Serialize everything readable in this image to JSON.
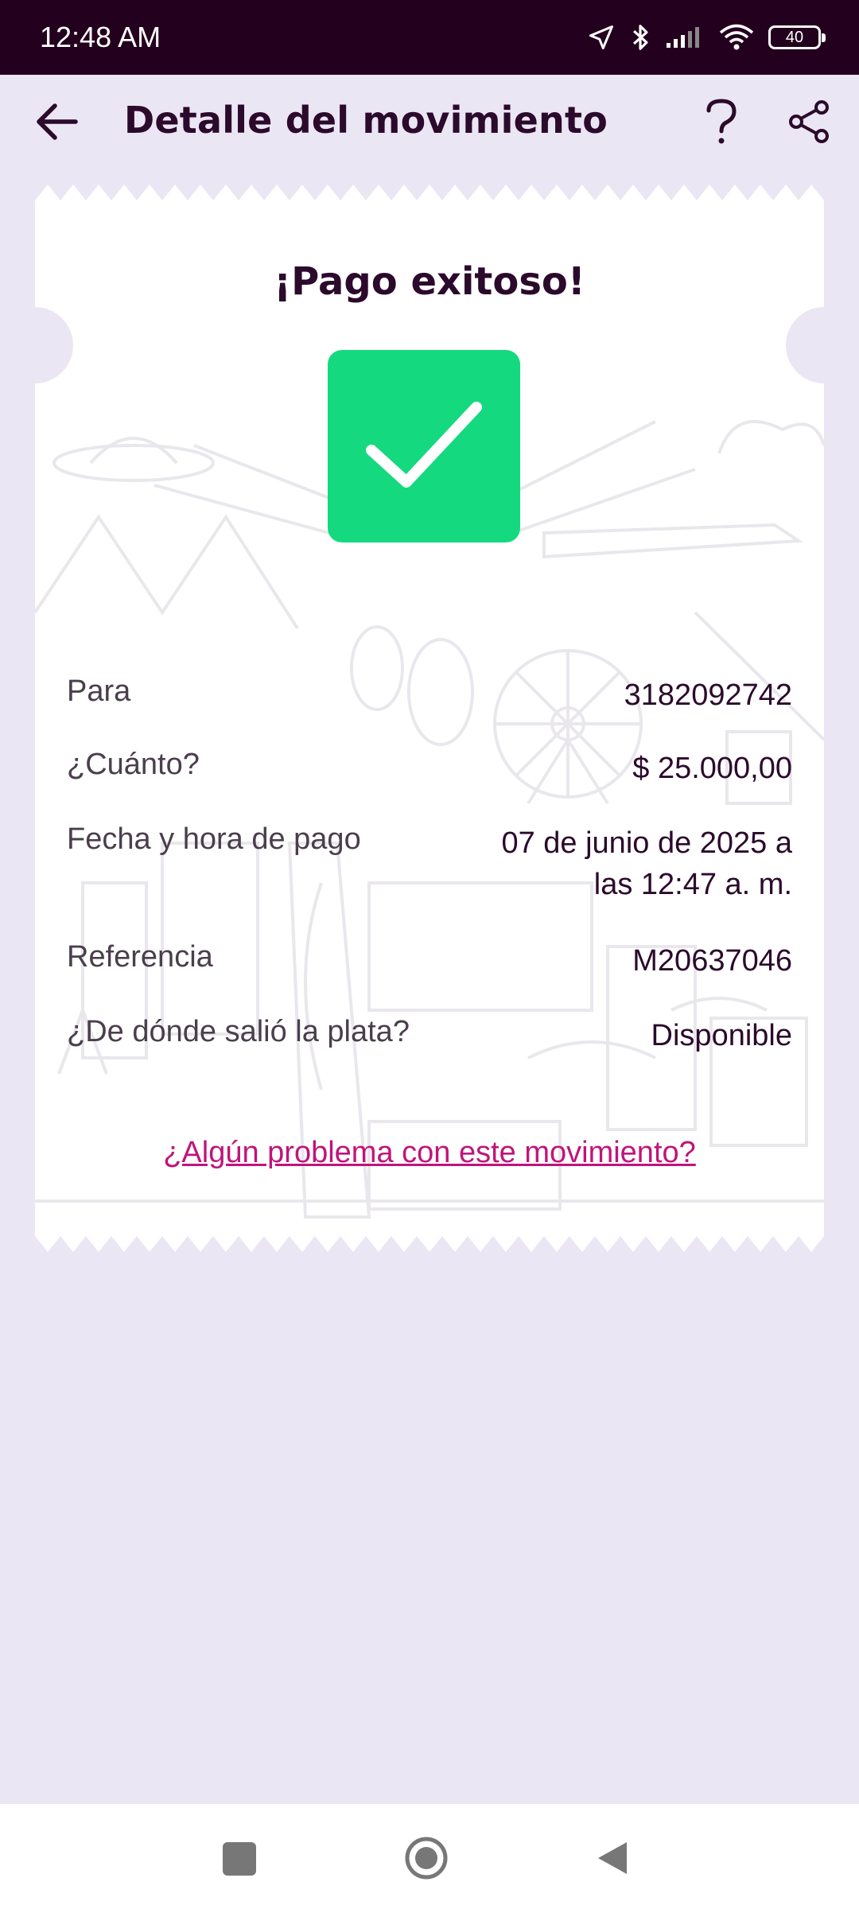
{
  "status_bar": {
    "time": "12:48 AM",
    "battery": "40",
    "icons": [
      "location-icon",
      "bluetooth-icon",
      "signal-icon",
      "wifi-icon",
      "battery-icon"
    ]
  },
  "header": {
    "title": "Detalle del movimiento",
    "icons": [
      "back-arrow-icon",
      "help-icon",
      "share-icon"
    ]
  },
  "receipt": {
    "title": "¡Pago exitoso!",
    "status_icon": "check-icon",
    "rows": [
      {
        "label": "Para",
        "value": "3182092742"
      },
      {
        "label": "¿Cuánto?",
        "value": "$ 25.000,00"
      },
      {
        "label": "Fecha y hora de pago",
        "value_line1": "07 de junio de 2025 a",
        "value_line2": "las 12:47 a. m."
      },
      {
        "label": "Referencia",
        "value": "M20637046"
      },
      {
        "label": "¿De dónde salió la plata?",
        "value": "Disponible"
      }
    ],
    "problem_link": "¿Algún problema con este movimiento?"
  },
  "colors": {
    "status_bar": "#23001e",
    "background": "#ebe6f4",
    "success_green": "#14d97f",
    "link_magenta": "#c0147b",
    "title_text": "#2b0a2c"
  },
  "nav_bar": {
    "icons": [
      "recent-apps-icon",
      "home-icon",
      "back-icon"
    ]
  }
}
